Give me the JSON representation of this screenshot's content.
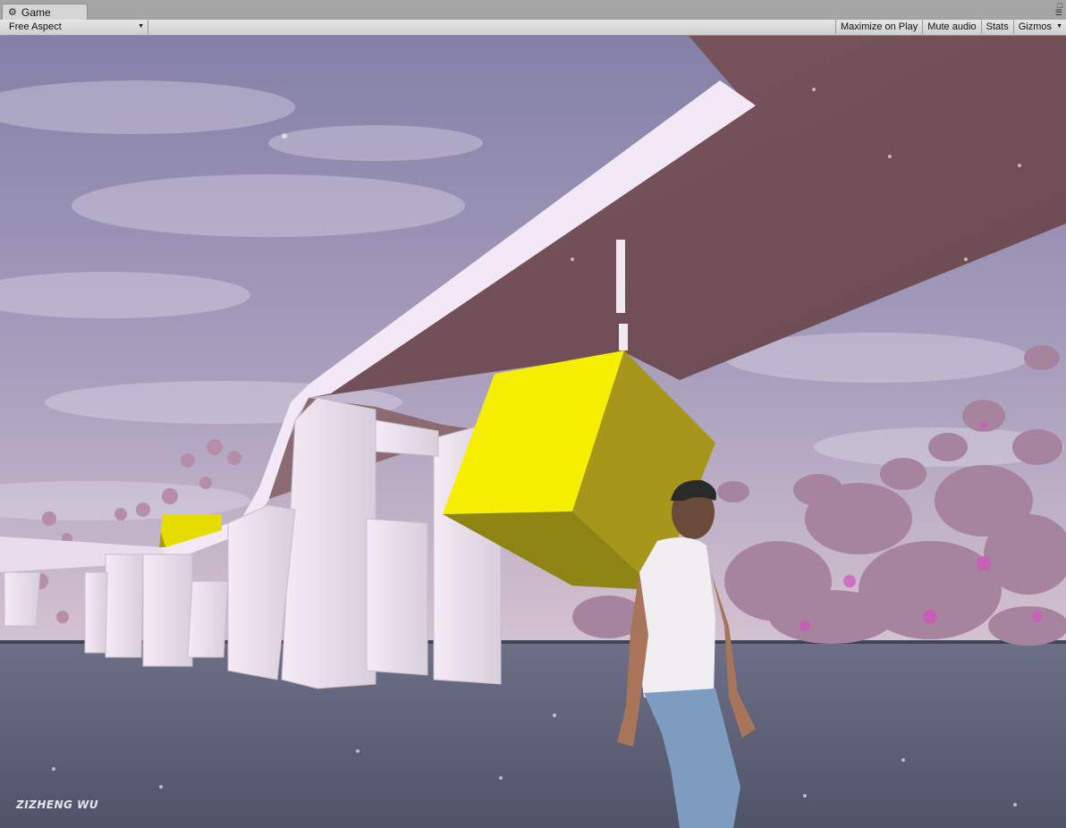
{
  "window": {
    "tab_label": "Game",
    "tab_icon": "game-controller-icon"
  },
  "toolbar": {
    "aspect_label": "Free Aspect",
    "maximize_label": "Maximize on Play",
    "mute_label": "Mute audio",
    "stats_label": "Stats",
    "gizmos_label": "Gizmos"
  },
  "viewport": {
    "watermark": "ZIZHENG WU",
    "colors": {
      "sky_top": "#8a86ac",
      "sky_bottom": "#c9bccb",
      "ground": "#5b5e74",
      "deck_underside": "#7d5a61",
      "rail": "#f3e9f6",
      "cube_front": "#f6f000",
      "cube_side": "#a89a14",
      "flowers": "#a6849d"
    }
  }
}
